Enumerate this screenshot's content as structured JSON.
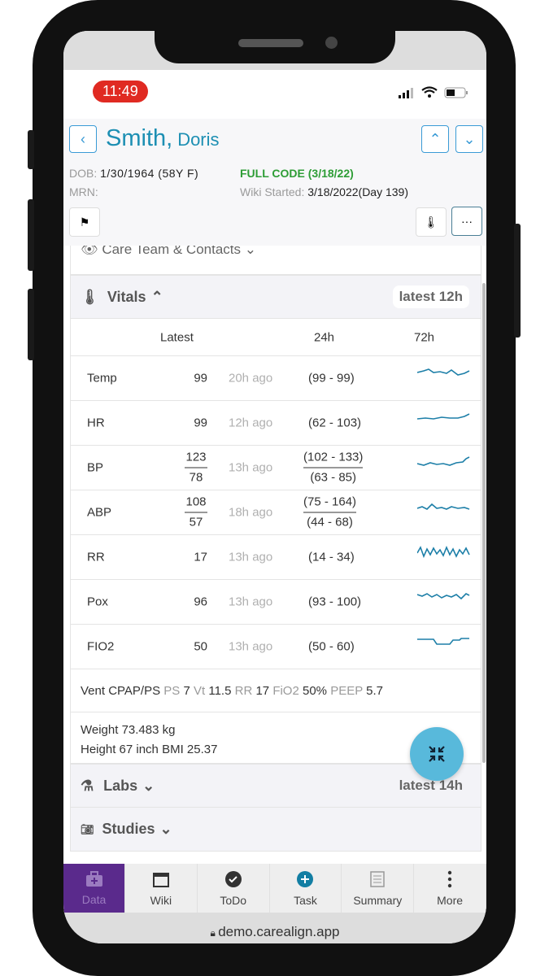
{
  "status": {
    "time": "11:49"
  },
  "header": {
    "last_name": "Smith,",
    "first_name": "Doris",
    "dob_label": "DOB:",
    "dob": "1/30/1964 (58Y F)",
    "code_status": "FULL CODE (3/18/22)",
    "mrn_label": "MRN:",
    "wiki_label": "Wiki Started:",
    "wiki_started": "3/18/2022(Day 139)"
  },
  "care_team": {
    "label": "Care Team & Contacts"
  },
  "vitals": {
    "label": "Vitals",
    "range": "latest 12h",
    "columns": [
      "Latest",
      "24h",
      "72h"
    ],
    "rows": [
      {
        "name": "Temp",
        "latest": "99",
        "ago": "20h ago",
        "range": "(99 - 99)"
      },
      {
        "name": "HR",
        "latest": "99",
        "ago": "12h ago",
        "range": "(62 - 103)"
      },
      {
        "name": "BP",
        "latest_top": "123",
        "latest_bottom": "78",
        "ago": "13h ago",
        "range_top": "(102 - 133)",
        "range_bottom": "(63 - 85)"
      },
      {
        "name": "ABP",
        "latest_top": "108",
        "latest_bottom": "57",
        "ago": "18h ago",
        "range_top": "(75 - 164)",
        "range_bottom": "(44 - 68)"
      },
      {
        "name": "RR",
        "latest": "17",
        "ago": "13h ago",
        "range": "(14 - 34)"
      },
      {
        "name": "Pox",
        "latest": "96",
        "ago": "13h ago",
        "range": "(93 - 100)"
      },
      {
        "name": "FIO2",
        "latest": "50",
        "ago": "13h ago",
        "range": "(50 - 60)"
      }
    ],
    "vent": {
      "mode": "Vent CPAP/PS",
      "ps_label": "PS",
      "ps": "7",
      "vt_label": "Vt",
      "vt": "11.5",
      "rr_label": "RR",
      "rr": "17",
      "fio2_label": "FiO2",
      "fio2": "50%",
      "peep_label": "PEEP",
      "peep": "5.7"
    },
    "weight": "Weight 73.483 kg",
    "height": "Height 67 inch BMI 25.37"
  },
  "labs": {
    "label": "Labs",
    "range": "latest 14h"
  },
  "studies": {
    "label": "Studies"
  },
  "nav": [
    {
      "label": "Data",
      "icon": "medkit-icon"
    },
    {
      "label": "Wiki",
      "icon": "calendar-icon"
    },
    {
      "label": "ToDo",
      "icon": "check-circle-icon"
    },
    {
      "label": "Task",
      "icon": "plus-circle-icon"
    },
    {
      "label": "Summary",
      "icon": "document-icon"
    },
    {
      "label": "More",
      "icon": "more-vertical-icon"
    }
  ],
  "url": "demo.carealign.app",
  "colors": {
    "accent": "#1d8fb3",
    "code": "#2e9d36",
    "nav_active": "#5a2a8c",
    "fab": "#58b9db",
    "sparkline": "#1d7fa8"
  }
}
